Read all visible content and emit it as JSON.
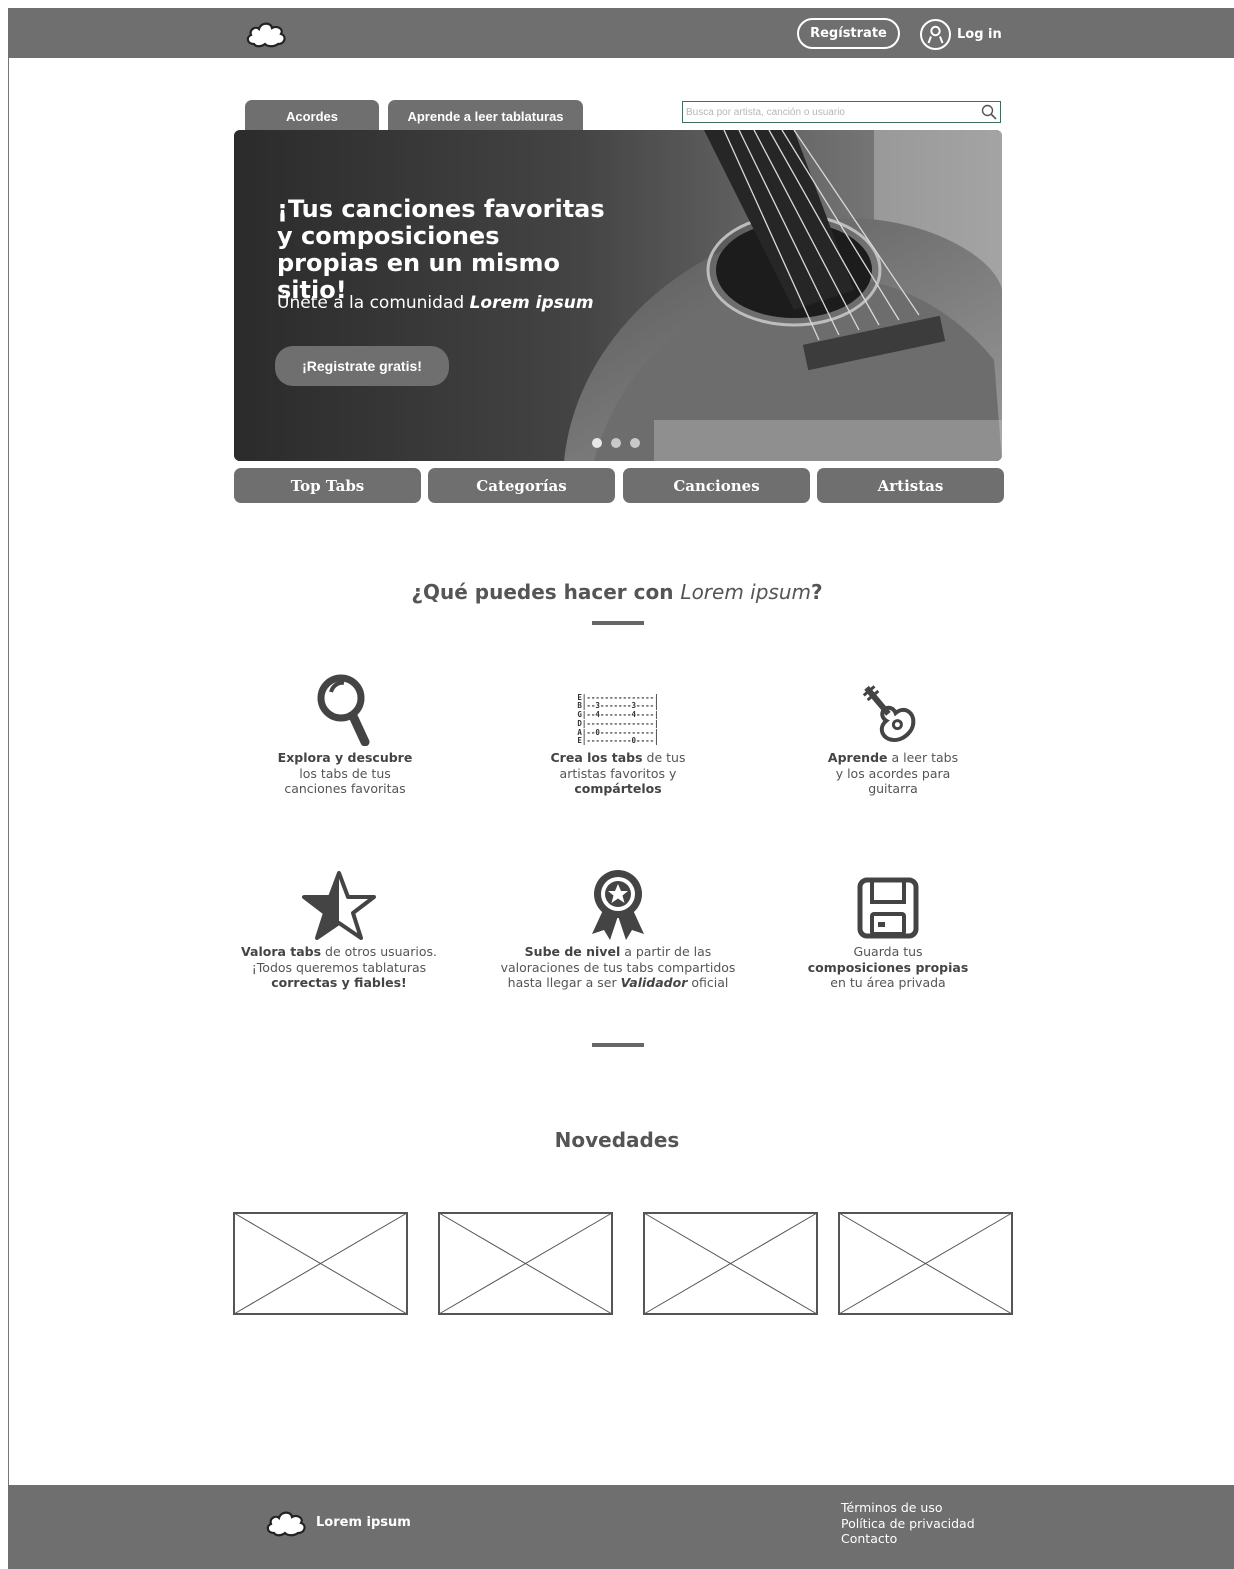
{
  "header": {
    "register_label": "Regístrate",
    "login_label": "Log in"
  },
  "tabs": [
    {
      "label": "Acordes"
    },
    {
      "label": "Aprende a leer tablaturas"
    }
  ],
  "search": {
    "placeholder": "Busca por artista, canción o usuario"
  },
  "hero": {
    "title": "¡Tus canciones favoritas y composiciones propias en un mismo sitio!",
    "subtitle_prefix": "Únete a la comunidad",
    "subtitle_brand": "Lorem ipsum",
    "cta_label": "¡Registrate gratis!",
    "slides": 3,
    "active_slide": 1
  },
  "nav": [
    {
      "label": "Top Tabs"
    },
    {
      "label": "Categorías"
    },
    {
      "label": "Canciones"
    },
    {
      "label": "Artistas"
    }
  ],
  "features_section": {
    "title_prefix": "¿Qué puedes hacer con",
    "title_brand": "Lorem ipsum",
    "title_suffix": "?"
  },
  "features": [
    {
      "icon": "magnifier-icon",
      "bold": "Explora y descubre",
      "rest1": "los tabs de tus",
      "rest2": "canciones favoritas"
    },
    {
      "icon": "tablature-icon",
      "tab_lines": [
        "E|---------------|",
        "B|--3-------3----|",
        "G|--4-------4----|",
        "D|---------------|",
        "A|--0------------|",
        "E|----------0----|"
      ],
      "bold": "Crea los tabs",
      "rest1": " de tus",
      "rest2": "artistas favoritos y",
      "bold2": "compártelos"
    },
    {
      "icon": "guitar-icon",
      "bold": "Aprende",
      "rest1": " a leer tabs",
      "rest2": "y los acordes para",
      "rest3": "guitarra"
    },
    {
      "icon": "half-star-icon",
      "bold": "Valora tabs",
      "rest1": " de otros usuarios.",
      "rest2": "¡Todos queremos tablaturas",
      "bold2": "correctas y fiables!"
    },
    {
      "icon": "award-badge-icon",
      "bold": "Sube de nivel",
      "rest1": " a partir de las",
      "rest2": "valoraciones de tus tabs compartidos",
      "rest3": "hasta llegar a ser ",
      "bold2": "Validador",
      "rest4": " oficial"
    },
    {
      "icon": "floppy-disk-icon",
      "rest1": "Guarda tus",
      "bold": "composiciones propias",
      "rest2": "en tu área privada"
    }
  ],
  "news": {
    "title": "Novedades",
    "items": 4
  },
  "footer": {
    "brand": "Lorem ipsum",
    "links": [
      "Términos de uso",
      "Política de privacidad",
      "Contacto"
    ]
  },
  "colors": {
    "bar": "#6f6f6f",
    "text": "#555555",
    "search_border": "#3d6e60"
  }
}
